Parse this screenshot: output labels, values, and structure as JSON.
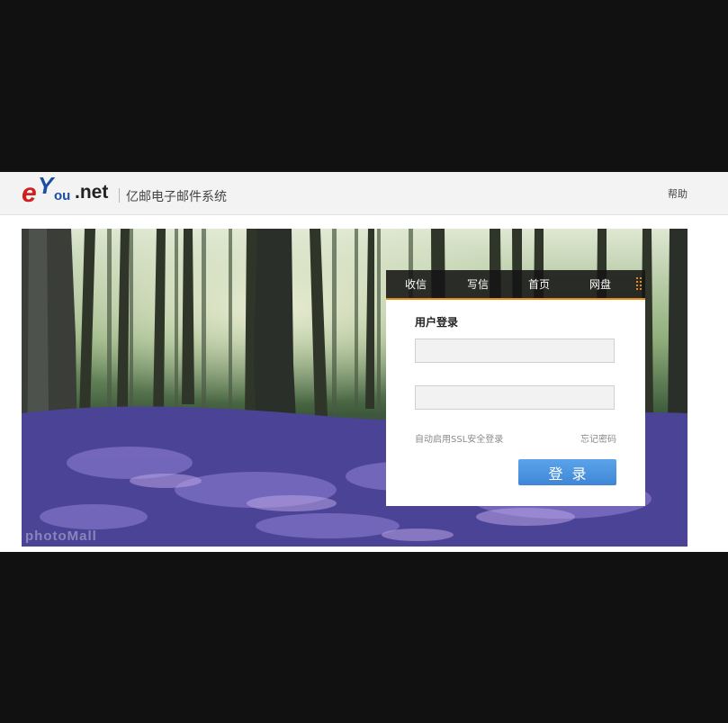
{
  "header": {
    "logo": {
      "e": "e",
      "y": "Y",
      "ou": "ou",
      "net": ".net"
    },
    "site_title": "亿邮电子邮件系统",
    "help_label": "帮助"
  },
  "banner": {
    "watermark": "photoMall"
  },
  "login": {
    "tabs": [
      "收信",
      "写信",
      "首页",
      "网盘"
    ],
    "title": "用户登录",
    "username": {
      "value": "",
      "placeholder": ""
    },
    "password": {
      "value": "",
      "placeholder": ""
    },
    "ssl_label": "自动启用SSL安全登录",
    "forgot_label": "忘记密码",
    "submit_label": "登录"
  },
  "colors": {
    "background": "#111111",
    "header_bg": "#f3f3f3",
    "accent_orange": "#e98a1d",
    "button_blue": "#4a90e2",
    "logo_red": "#d01f1f",
    "logo_blue": "#1c4ea1"
  },
  "icons": {
    "grid": "grid-dots-icon"
  }
}
